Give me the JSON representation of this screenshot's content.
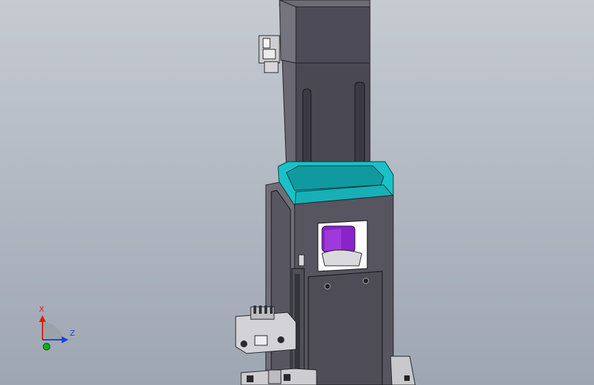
{
  "viewport": {
    "background_top": "#c6cbd2",
    "background_bottom": "#9ea6b2"
  },
  "model": {
    "motor_color": "#4d4b57",
    "bracket_color": "#565560",
    "coupling_ring_color": "#19c2c8",
    "coupler_color": "#8a23c9"
  },
  "triad": {
    "x_label": "X",
    "z_label": "Z",
    "x_color": "#d81e1e",
    "z_color": "#1f3fd8",
    "y_color": "#1aa81a"
  }
}
